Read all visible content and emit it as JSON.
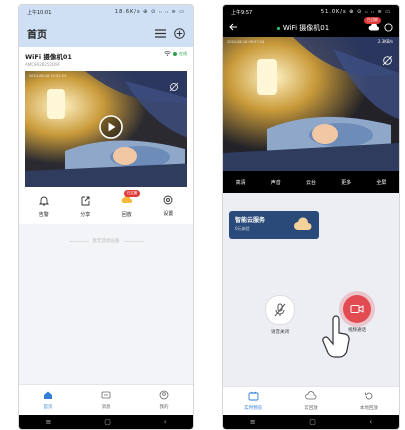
{
  "left": {
    "status": {
      "time": "上午10:01",
      "info": "18.6K/s ⊕ ⊙ ᵢᵢ ᵢᵢ ≋ ▭"
    },
    "header": {
      "title": "首页"
    },
    "device": {
      "name": "WiFi 摄像机01",
      "id": "AMC9A28252D9F",
      "status": "在线",
      "timestamp": "2024-08-16  10:01:23"
    },
    "toolbar": {
      "alert": "告警",
      "share": "分享",
      "playback": "回放",
      "playback_badge": "已过期",
      "settings": "设置"
    },
    "empty_text": "暂无其他设备",
    "nav": {
      "home": "首页",
      "messages": "消息",
      "mine": "我的"
    }
  },
  "right": {
    "status": {
      "time": "上午9:57",
      "info": "51.0K/s ⊕ ⊙ ᵢᵢ ᵢᵢ ≋ ▭"
    },
    "header": {
      "title": "WiFi 摄像机01",
      "badge": "已过期"
    },
    "video": {
      "timestamp": "2024-08-16  09:57:24",
      "speed": "2.3KB/s"
    },
    "controls": {
      "quality": "高清",
      "sound": "声音",
      "ptz": "云台",
      "more": "更多",
      "fullscreen": "全屏"
    },
    "cloud": {
      "title": "智能云服务",
      "subtitle": "0元体验"
    },
    "mic": {
      "label": "语音关闭"
    },
    "call": {
      "label": "视频通话"
    },
    "nav": {
      "live": "实时预览",
      "cloud": "云回放",
      "local": "本地回放"
    }
  },
  "colors": {
    "accent": "#2f7fd8",
    "online": "#2aa148",
    "call": "#e34b52",
    "cloud_card": "#2a4a7a"
  }
}
